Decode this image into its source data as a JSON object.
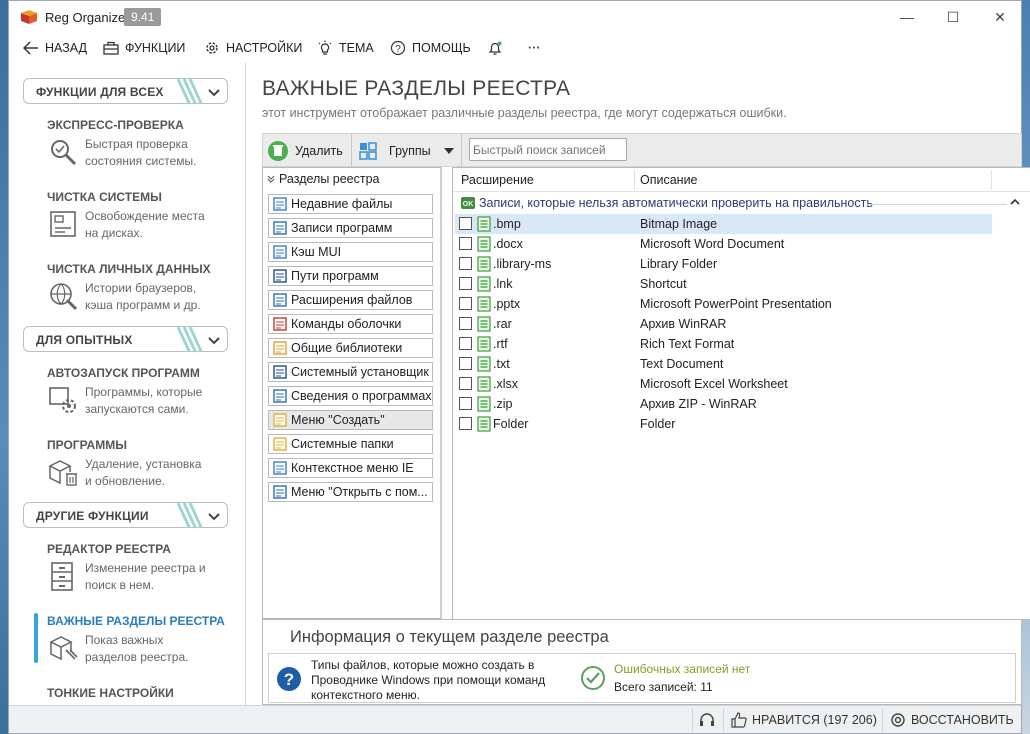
{
  "window": {
    "title": "Reg Organizer",
    "version": "9.41",
    "minimize": "—",
    "maximize": "☐",
    "close": "✕"
  },
  "menu": {
    "back": "НАЗАД",
    "functions": "ФУНКЦИИ",
    "settings": "НАСТРОЙКИ",
    "theme": "ТЕМА",
    "help": "ПОМОЩЬ",
    "more": "···"
  },
  "sidebar": {
    "section_all": "ФУНКЦИИ ДЛЯ ВСЕХ",
    "express": {
      "title": "ЭКСПРЕСС-ПРОВЕРКА",
      "desc": [
        "Быстрая проверка",
        "состояния системы."
      ]
    },
    "cleanup": {
      "title": "ЧИСТКА СИСТЕМЫ",
      "desc": [
        "Освобождение места",
        "на дисках."
      ]
    },
    "private": {
      "title": "ЧИСТКА ЛИЧНЫХ ДАННЫХ",
      "desc": [
        "Истории браузеров,",
        "кэша программ и др."
      ]
    },
    "section_expert": "ДЛЯ ОПЫТНЫХ",
    "autorun": {
      "title": "АВТОЗАПУСК ПРОГРАММ",
      "desc": [
        "Программы, которые",
        "запускаются сами."
      ]
    },
    "programs": {
      "title": "ПРОГРАММЫ",
      "desc": [
        "Удаление, установка",
        "и обновление."
      ]
    },
    "section_other": "ДРУГИЕ ФУНКЦИИ",
    "regedit": {
      "title": "РЕДАКТОР РЕЕСТРА",
      "desc": [
        "Изменение реестра и",
        "поиск в нем."
      ]
    },
    "important": {
      "title": "ВАЖНЫЕ РАЗДЕЛЫ РЕЕСТРА",
      "desc": [
        "Показ важных",
        "разделов реестра."
      ]
    },
    "tweaks": {
      "title": "ТОНКИЕ НАСТРОЙКИ"
    }
  },
  "page": {
    "title": "ВАЖНЫЕ РАЗДЕЛЫ РЕЕСТРА",
    "subtitle": "этот инструмент отображает различные разделы реестра, где могут содержаться ошибки."
  },
  "toolbar": {
    "delete": "Удалить",
    "groups": "Группы",
    "search_placeholder": "Быстрый поиск записей"
  },
  "tree": {
    "header": "Разделы реестра",
    "items": [
      {
        "label": "Недавние файлы",
        "icon": "recent-files-icon"
      },
      {
        "label": "Записи программ",
        "icon": "program-records-icon"
      },
      {
        "label": "Кэш MUI",
        "icon": "mui-cache-icon"
      },
      {
        "label": "Пути программ",
        "icon": "program-paths-icon"
      },
      {
        "label": "Расширения файлов",
        "icon": "file-extensions-icon"
      },
      {
        "label": "Команды оболочки",
        "icon": "shell-commands-icon"
      },
      {
        "label": "Общие библиотеки",
        "icon": "shared-libraries-icon"
      },
      {
        "label": "Системный установщик",
        "icon": "system-installer-icon"
      },
      {
        "label": "Сведения о программах",
        "icon": "program-info-icon"
      },
      {
        "label": "Меню \"Создать\"",
        "icon": "new-menu-icon"
      },
      {
        "label": "Системные папки",
        "icon": "system-folders-icon"
      },
      {
        "label": "Контекстное меню IE",
        "icon": "ie-context-menu-icon"
      },
      {
        "label": "Меню \"Открыть с пом...",
        "icon": "open-with-menu-icon"
      }
    ],
    "selected_index": 9
  },
  "list": {
    "col_extension": "Расширение",
    "col_description": "Описание",
    "group_label": "Записи, которые нельзя автоматически проверить на правильность",
    "rows": [
      {
        "ext": ".bmp",
        "desc": "Bitmap Image"
      },
      {
        "ext": ".docx",
        "desc": "Microsoft Word Document"
      },
      {
        "ext": ".library-ms",
        "desc": "Library Folder"
      },
      {
        "ext": ".lnk",
        "desc": "Shortcut"
      },
      {
        "ext": ".pptx",
        "desc": "Microsoft PowerPoint Presentation"
      },
      {
        "ext": ".rar",
        "desc": "Архив WinRAR"
      },
      {
        "ext": ".rtf",
        "desc": "Rich Text Format"
      },
      {
        "ext": ".txt",
        "desc": "Text Document"
      },
      {
        "ext": ".xlsx",
        "desc": "Microsoft Excel Worksheet"
      },
      {
        "ext": ".zip",
        "desc": "Архив ZIP - WinRAR"
      },
      {
        "ext": "Folder",
        "desc": "Folder"
      }
    ],
    "selected_index": 0
  },
  "info": {
    "title": "Информация о текущем разделе реестра",
    "text": "Типы файлов, которые можно создать в Проводнике Windows при помощи команд контекстного меню.",
    "status": "Ошибочных записей нет",
    "count": "Всего записей: 11"
  },
  "statusbar": {
    "like": "НРАВИТСЯ (197 206)",
    "restore": "ВОССТАНОВИТЬ"
  },
  "colors": {
    "accent": "#3aa3dc",
    "title_text": "#444444",
    "ok_green": "#8a9a2a",
    "selection": "#d9e8f7"
  }
}
